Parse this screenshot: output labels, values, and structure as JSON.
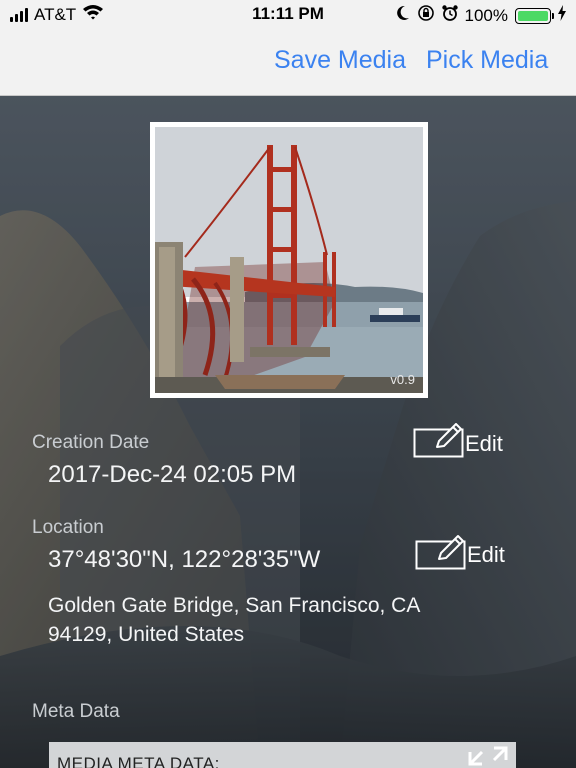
{
  "status_bar": {
    "carrier": "AT&T",
    "time": "11:11 PM",
    "battery": "100%",
    "icons": [
      "signal-icon",
      "wifi-icon",
      "moon-icon",
      "rotation-lock-icon",
      "alarm-icon",
      "battery-icon",
      "charging-icon"
    ]
  },
  "nav": {
    "save_label": "Save Media",
    "pick_label": "Pick Media",
    "accent_color": "#3b82f0"
  },
  "photo": {
    "version": "v0.9"
  },
  "creation": {
    "label": "Creation Date",
    "value": "2017-Dec-24 02:05 PM",
    "edit_label": "Edit"
  },
  "location": {
    "label": "Location",
    "coords": "37°48'30\"N, 122°28'35\"W",
    "address_line1": "Golden Gate Bridge, San Francisco, CA",
    "address_line2": "94129, United States",
    "edit_label": "Edit"
  },
  "meta": {
    "label": "Meta Data",
    "box_title": "MEDIA META DATA:"
  }
}
